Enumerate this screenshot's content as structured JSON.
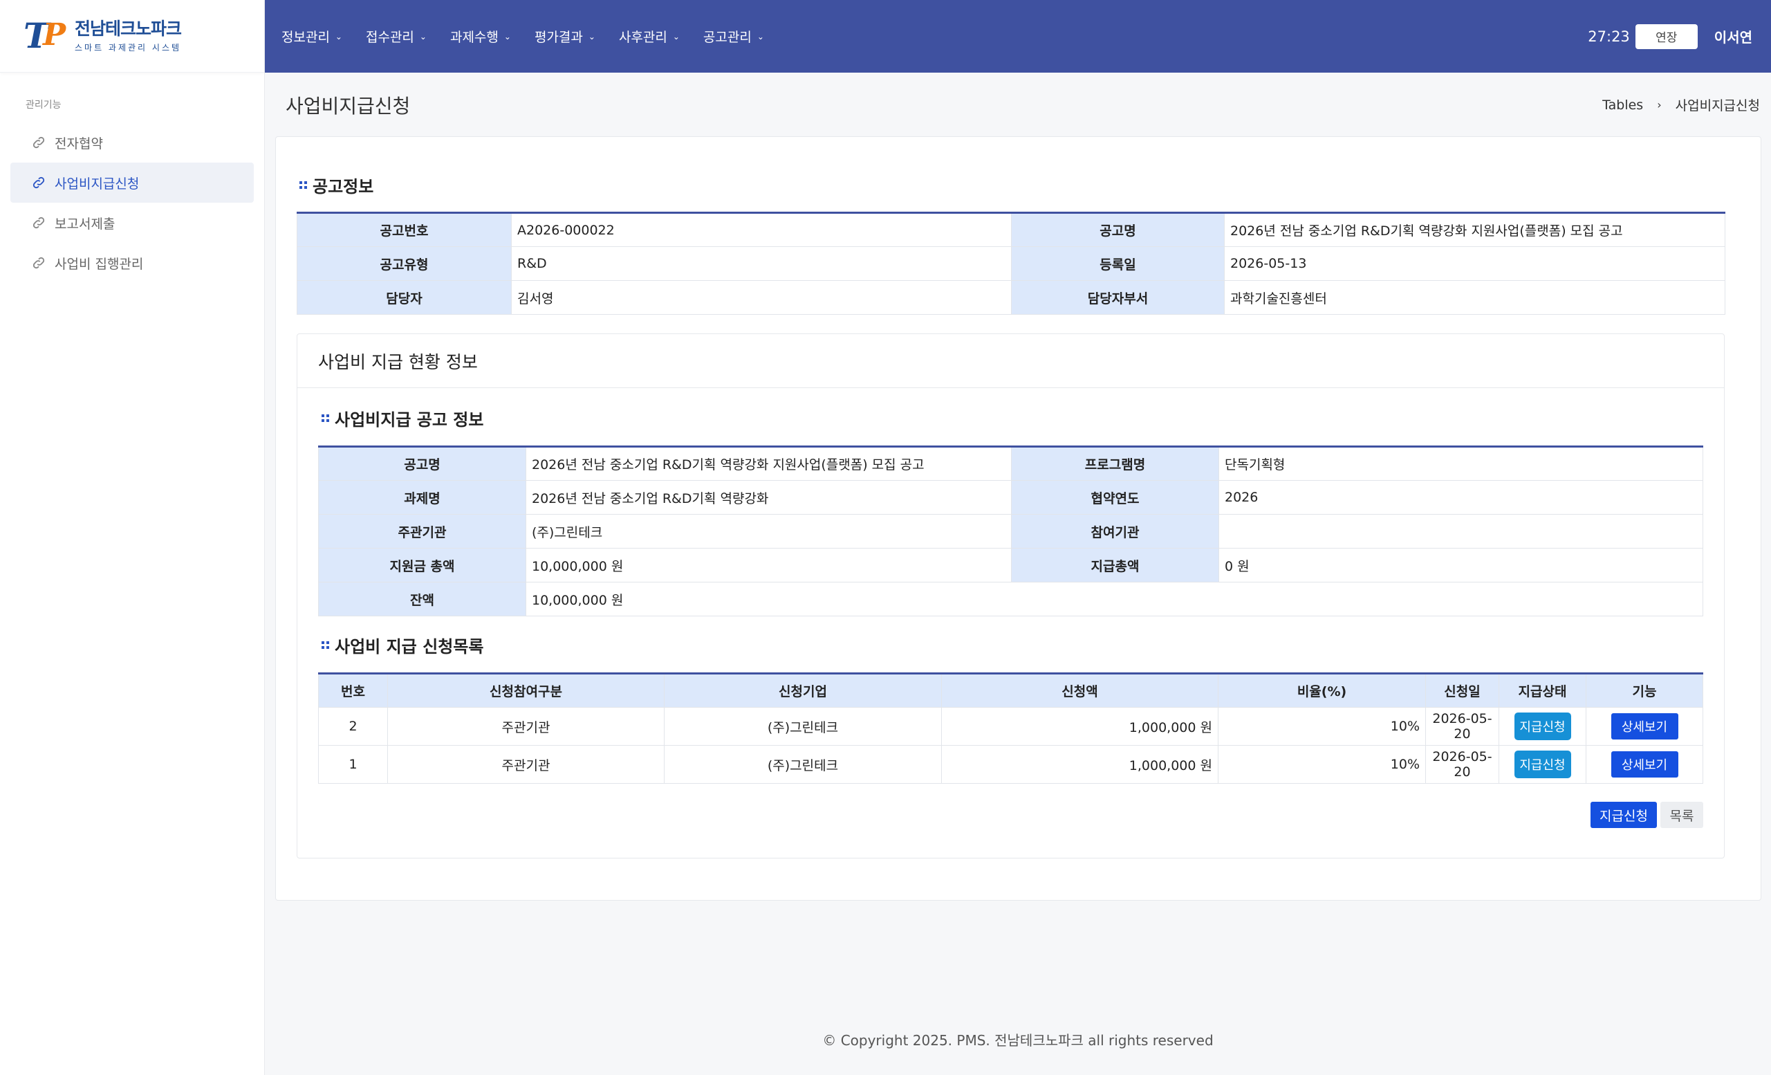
{
  "logo": {
    "name": "전남테크노파크",
    "sub": "스마트 과제관리 시스템",
    "mark_t": "T",
    "mark_p": "P"
  },
  "sidebar": {
    "section": "관리기능",
    "items": [
      {
        "label": "전자협약"
      },
      {
        "label": "사업비지급신청"
      },
      {
        "label": "보고서제출"
      },
      {
        "label": "사업비 집행관리"
      }
    ]
  },
  "topbar": {
    "menu": [
      {
        "label": "정보관리"
      },
      {
        "label": "접수관리"
      },
      {
        "label": "과제수행"
      },
      {
        "label": "평가결과"
      },
      {
        "label": "사후관리"
      },
      {
        "label": "공고관리"
      }
    ],
    "timer": "27:23",
    "extend_label": "연장",
    "user": "이서연"
  },
  "page": {
    "title": "사업비지급신청",
    "breadcrumb": [
      "Tables",
      "사업비지급신청"
    ]
  },
  "notice": {
    "title": "공고정보",
    "rows": [
      {
        "l1": "공고번호",
        "v1": "A2026-000022",
        "l2": "공고명",
        "v2": "2026년 전남 중소기업 R&D기획 역량강화 지원사업(플랫폼) 모집 공고"
      },
      {
        "l1": "공고유형",
        "v1": "R&D",
        "l2": "등록일",
        "v2": "2026-05-13"
      },
      {
        "l1": "담당자",
        "v1": "김서영",
        "l2": "담당자부서",
        "v2": "과학기술진흥센터"
      }
    ]
  },
  "status": {
    "card_title": "사업비 지급 현황 정보",
    "info_title": "사업비지급 공고 정보",
    "rows": [
      {
        "l1": "공고명",
        "v1": "2026년 전남 중소기업 R&D기획 역량강화 지원사업(플랫폼) 모집 공고",
        "l2": "프로그램명",
        "v2": "단독기획형"
      },
      {
        "l1": "과제명",
        "v1": "2026년 전남 중소기업 R&D기획 역량강화",
        "l2": "협약연도",
        "v2": "2026"
      },
      {
        "l1": "주관기관",
        "v1": "(주)그린테크",
        "l2": "참여기관",
        "v2": ""
      },
      {
        "l1": "지원금 총액",
        "v1": "10,000,000 원",
        "l2": "지급총액",
        "v2": "0 원"
      }
    ],
    "balance_label": "잔액",
    "balance_value": "10,000,000 원"
  },
  "list": {
    "title": "사업비 지급 신청목록",
    "headers": [
      "번호",
      "신청참여구분",
      "신청기업",
      "신청액",
      "비율(%)",
      "신청일",
      "지급상태",
      "기능"
    ],
    "rows": [
      {
        "no": "2",
        "type": "주관기관",
        "company": "(주)그린테크",
        "amount": "1,000,000 원",
        "ratio": "10%",
        "date": "2026-05-20",
        "status": "지급신청",
        "action": "상세보기"
      },
      {
        "no": "1",
        "type": "주관기관",
        "company": "(주)그린테크",
        "amount": "1,000,000 원",
        "ratio": "10%",
        "date": "2026-05-20",
        "status": "지급신청",
        "action": "상세보기"
      }
    ]
  },
  "buttons": {
    "apply": "지급신청",
    "list": "목록"
  },
  "footer": "© Copyright 2025. PMS. 전남테크노파크 all rights reserved"
}
